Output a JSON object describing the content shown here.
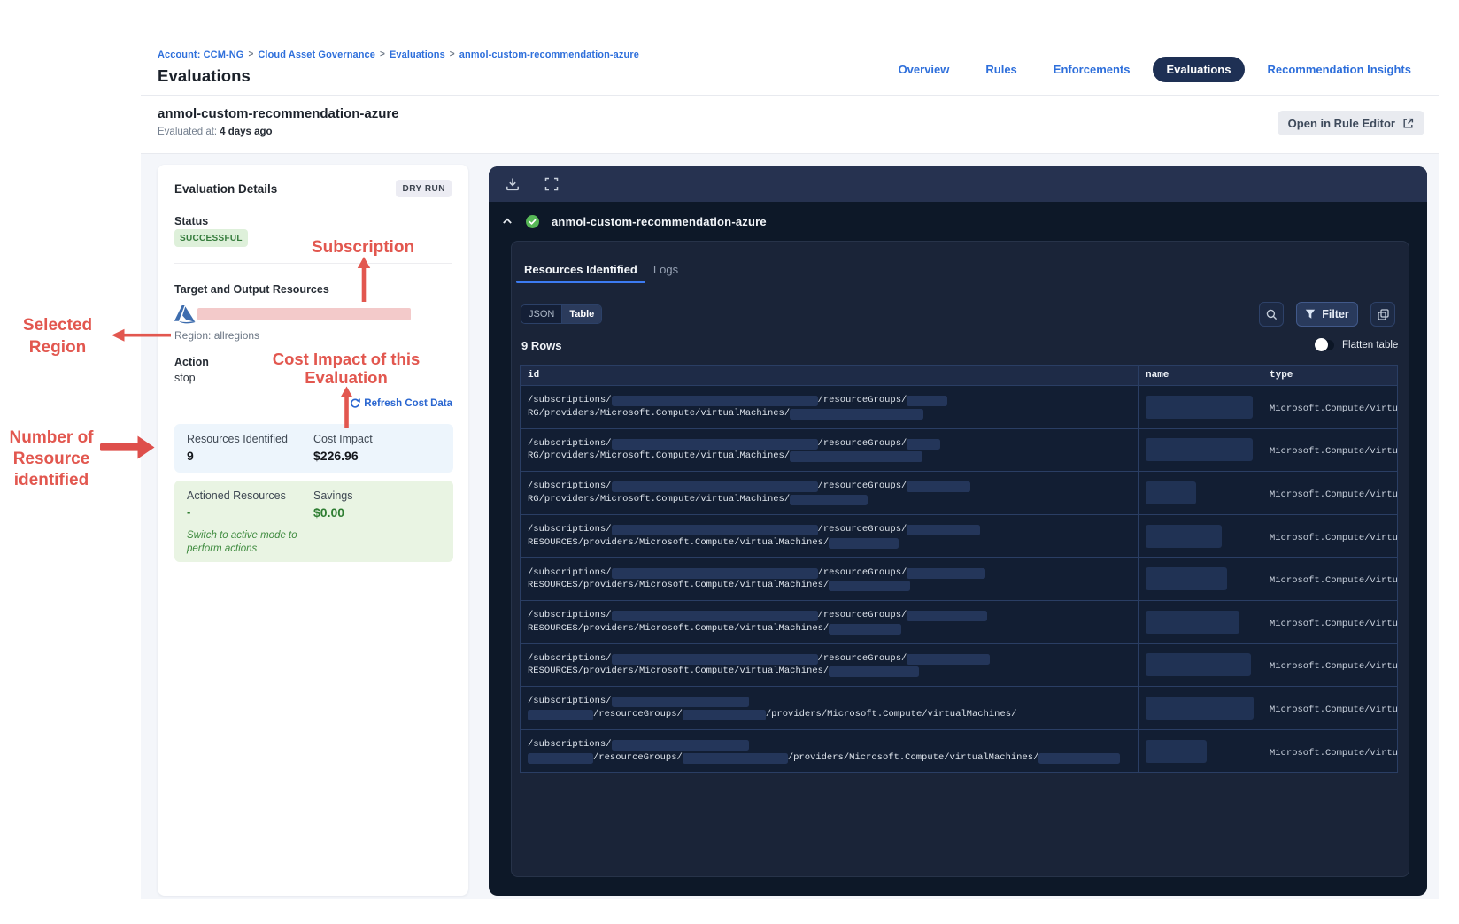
{
  "colors": {
    "annotation_red": "#e2574f",
    "accent_blue": "#2e6fdb",
    "panel_dark": "#0e1a2c",
    "tab_underline": "#3c7bf2",
    "success_green": "#2e7d32"
  },
  "header": {
    "breadcrumb": [
      "Account: CCM-NG",
      "Cloud Asset Governance",
      "Evaluations",
      "anmol-custom-recommendation-azure"
    ],
    "page_title": "Evaluations",
    "nav": [
      {
        "label": "Overview",
        "active": false
      },
      {
        "label": "Rules",
        "active": false
      },
      {
        "label": "Enforcements",
        "active": false
      },
      {
        "label": "Evaluations",
        "active": true
      },
      {
        "label": "Recommendation Insights",
        "active": false
      }
    ]
  },
  "subheader": {
    "title": "anmol-custom-recommendation-azure",
    "evaluated_label": "Evaluated at:",
    "evaluated_value": "4 days ago",
    "open_rule_editor_label": "Open in Rule Editor"
  },
  "details_card": {
    "title": "Evaluation Details",
    "mode_badge": "DRY RUN",
    "status_label": "Status",
    "status_value": "SUCCESSFUL",
    "target_label": "Target and Output Resources",
    "region_line": "Region: allregions",
    "action_label": "Action",
    "action_value": "stop",
    "refresh_link": "Refresh Cost Data",
    "resources_identified_label": "Resources Identified",
    "resources_identified_value": "9",
    "cost_impact_label": "Cost Impact",
    "cost_impact_value": "$226.96",
    "actioned_label": "Actioned Resources",
    "actioned_value": "-",
    "savings_label": "Savings",
    "savings_value": "$0.00",
    "note_line1": "Switch to active mode to",
    "note_line2": "perform actions"
  },
  "annotations": {
    "subscription": "Subscription",
    "selected_region_line1": "Selected",
    "selected_region_line2": "Region",
    "cost_impact_line1": "Cost Impact of this",
    "cost_impact_line2": "Evaluation",
    "number_line1": "Number of",
    "number_line2": "Resource",
    "number_line3": "identified"
  },
  "results_panel": {
    "title": "anmol-custom-recommendation-azure",
    "tabs": [
      {
        "label": "Resources Identified",
        "active": true
      },
      {
        "label": "Logs",
        "active": false
      }
    ],
    "view_modes": [
      {
        "label": "JSON",
        "active": false
      },
      {
        "label": "Table",
        "active": true
      }
    ],
    "filter_label": "Filter",
    "rows_count": "9 Rows",
    "flatten_label": "Flatten table",
    "table": {
      "headers": [
        "id",
        "name",
        "type"
      ],
      "rows": [
        {
          "l1": [
            "/subscriptions/",
            233,
            "/resourceGroups/",
            46
          ],
          "l2": [
            "RG/providers/Microsoft.Compute/virtualMachines/",
            151
          ],
          "name_bar": 121,
          "type": "Microsoft.Compute/virtu"
        },
        {
          "l1": [
            "/subscriptions/",
            233,
            "/resourceGroups/",
            38
          ],
          "l2": [
            "RG/providers/Microsoft.Compute/virtualMachines/",
            150
          ],
          "name_bar": 121,
          "type": "Microsoft.Compute/virtu"
        },
        {
          "l1": [
            "/subscriptions/",
            233,
            "/resourceGroups/",
            72
          ],
          "l2": [
            "RG/providers/Microsoft.Compute/virtualMachines/",
            88
          ],
          "name_bar": 57,
          "type": "Microsoft.Compute/virtu"
        },
        {
          "l1": [
            "/subscriptions/",
            233,
            "/resourceGroups/",
            83
          ],
          "l2": [
            "RESOURCES/providers/Microsoft.Compute/virtualMachines/",
            79
          ],
          "name_bar": 86,
          "type": "Microsoft.Compute/virtu"
        },
        {
          "l1": [
            "/subscriptions/",
            233,
            "/resourceGroups/",
            89
          ],
          "l2": [
            "RESOURCES/providers/Microsoft.Compute/virtualMachines/",
            92
          ],
          "name_bar": 92,
          "type": "Microsoft.Compute/virtu"
        },
        {
          "l1": [
            "/subscriptions/",
            233,
            "/resourceGroups/",
            91
          ],
          "l2": [
            "RESOURCES/providers/Microsoft.Compute/virtualMachines/",
            82
          ],
          "name_bar": 106,
          "type": "Microsoft.Compute/virtu"
        },
        {
          "l1": [
            "/subscriptions/",
            233,
            "/resourceGroups/",
            94
          ],
          "l2": [
            "RESOURCES/providers/Microsoft.Compute/virtualMachines/",
            102
          ],
          "name_bar": 119,
          "type": "Microsoft.Compute/virtu"
        },
        {
          "l1": [
            "/subscriptions/",
            155
          ],
          "l2": [
            74,
            "/resourceGroups/",
            94,
            "/providers/Microsoft.Compute/virtualMachines/"
          ],
          "name_bar": 122,
          "type": "Microsoft.Compute/virtu"
        },
        {
          "l1": [
            "/subscriptions/",
            155
          ],
          "l2": [
            74,
            "/resourceGroups/",
            119,
            "/providers/Microsoft.Compute/virtualMachines/",
            92
          ],
          "name_bar": 69,
          "type": "Microsoft.Compute/virtu"
        }
      ]
    }
  }
}
